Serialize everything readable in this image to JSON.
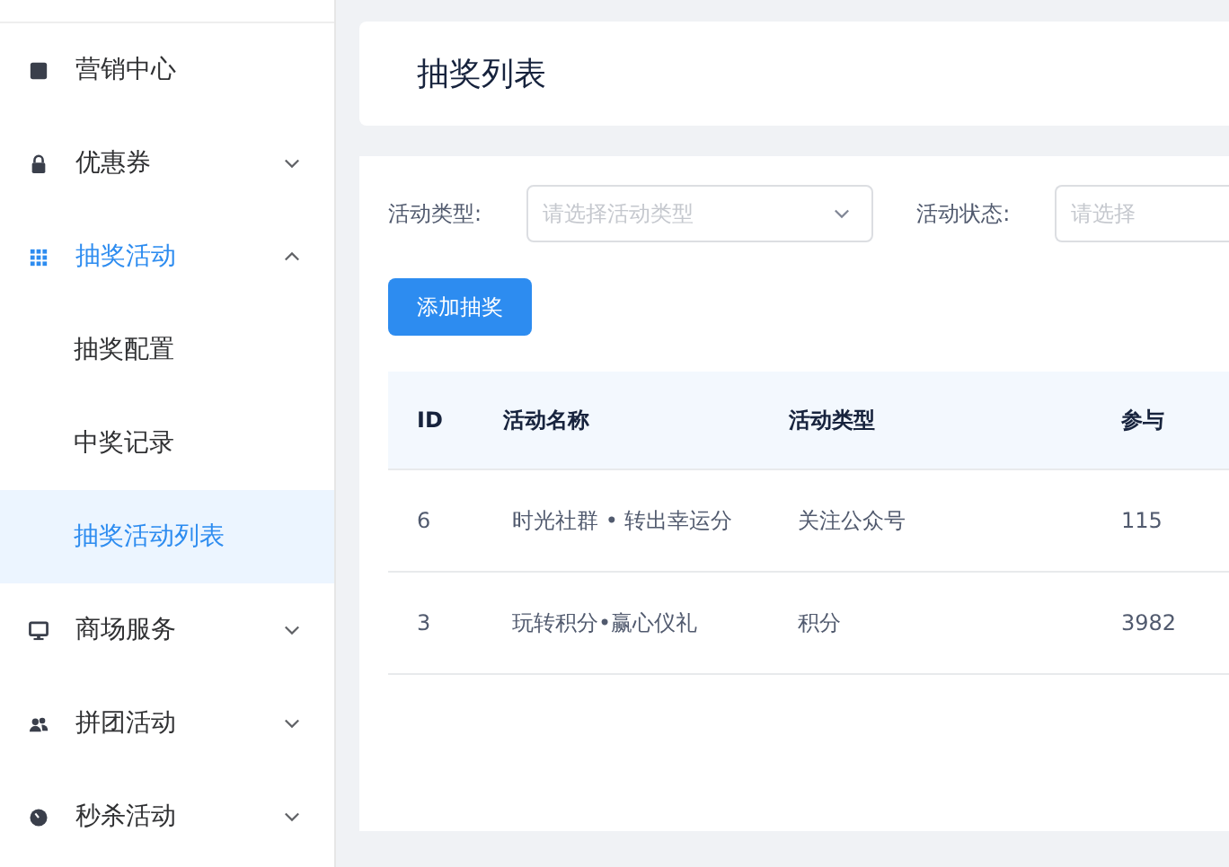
{
  "sidebar": {
    "items": [
      {
        "label": "营销中心",
        "kind": "link"
      },
      {
        "label": "优惠券",
        "kind": "group",
        "expanded": false
      },
      {
        "label": "抽奖活动",
        "kind": "group",
        "expanded": true,
        "children": [
          {
            "label": "抽奖配置",
            "selected": false
          },
          {
            "label": "中奖记录",
            "selected": false
          },
          {
            "label": "抽奖活动列表",
            "selected": true
          }
        ]
      },
      {
        "label": "商场服务",
        "kind": "group",
        "expanded": false
      },
      {
        "label": "拼团活动",
        "kind": "group",
        "expanded": false
      },
      {
        "label": "秒杀活动",
        "kind": "group",
        "expanded": false
      }
    ]
  },
  "header": {
    "title": "抽奖列表"
  },
  "filters": [
    {
      "label": "活动类型:",
      "placeholder": "请选择活动类型"
    },
    {
      "label": "活动状态:",
      "placeholder": "请选择"
    }
  ],
  "add_button": "添加抽奖",
  "table": {
    "columns": [
      "ID",
      "活动名称",
      "活动类型",
      "参与"
    ],
    "rows": [
      [
        "6",
        "时光社群 • 转出幸运分",
        "关注公众号",
        "115"
      ],
      [
        "3",
        "玩转积分•赢心仪礼",
        "积分",
        "3982"
      ]
    ]
  }
}
